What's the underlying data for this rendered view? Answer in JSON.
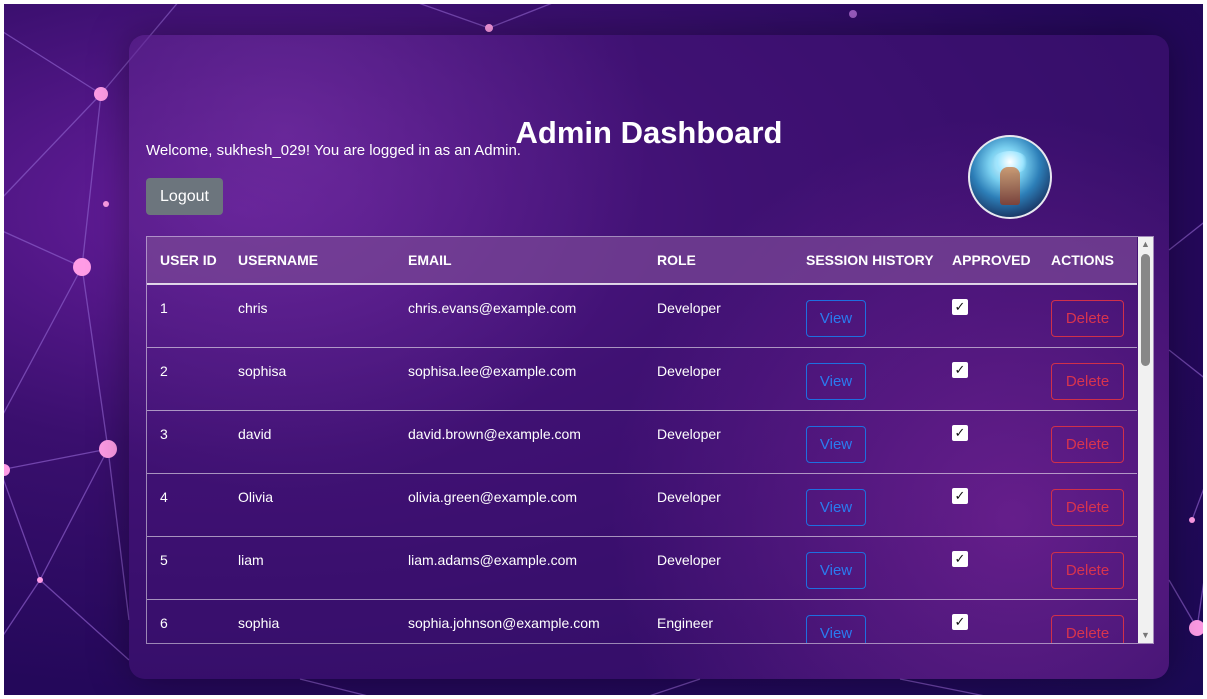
{
  "page": {
    "title": "Admin Dashboard",
    "welcome": "Welcome, sukhesh_029! You are logged in as an Admin.",
    "logout_label": "Logout"
  },
  "colors": {
    "view_button": "#2a7cf0",
    "delete_button": "#d8344e",
    "logout_bg": "#6c757d"
  },
  "table": {
    "headers": {
      "id": "USER ID",
      "username": "USERNAME",
      "email": "EMAIL",
      "role": "ROLE",
      "session": "SESSION HISTORY",
      "approved": "APPROVED",
      "actions": "ACTIONS"
    },
    "view_label": "View",
    "delete_label": "Delete",
    "rows": [
      {
        "id": "1",
        "username": "chris",
        "email": "chris.evans@example.com",
        "role": "Developer",
        "approved": true
      },
      {
        "id": "2",
        "username": "sophisa",
        "email": "sophisa.lee@example.com",
        "role": "Developer",
        "approved": true
      },
      {
        "id": "3",
        "username": "david",
        "email": "david.brown@example.com",
        "role": "Developer",
        "approved": true
      },
      {
        "id": "4",
        "username": "Olivia",
        "email": "olivia.green@example.com",
        "role": "Developer",
        "approved": true
      },
      {
        "id": "5",
        "username": "liam",
        "email": "liam.adams@example.com",
        "role": "Developer",
        "approved": true
      },
      {
        "id": "6",
        "username": "sophia",
        "email": "sophia.johnson@example.com",
        "role": "Engineer",
        "approved": true
      }
    ]
  }
}
